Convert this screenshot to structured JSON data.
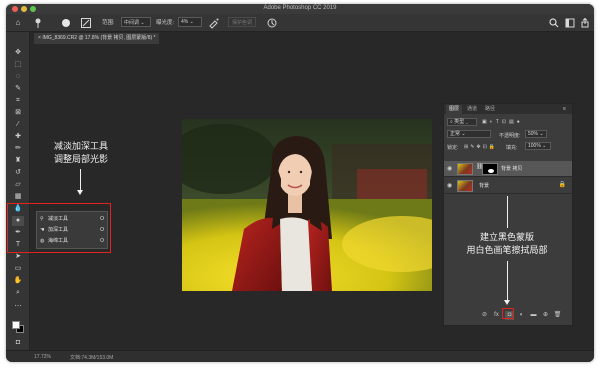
{
  "window": {
    "title": "Adobe Photoshop CC 2019"
  },
  "options_bar": {
    "range_label": "范围:",
    "range_value": "中间调",
    "exposure_label": "曝光度:",
    "exposure_value": "4%",
    "protect_tones_label": "保护色调",
    "icons": [
      "home-icon",
      "burn-brush-icon",
      "brush-size-icon",
      "brush-panel-icon",
      "airbrush-icon",
      "pressure-icon",
      "search-icon",
      "workspace-icon",
      "share-icon"
    ]
  },
  "document_tab": {
    "label": "IMG_8369.CR2 @ 17.8% (背景 拷贝, 图层蒙版/8) *"
  },
  "annotations": {
    "left_line1": "减淡加深工具",
    "left_line2": "调整局部光影",
    "right_line1": "建立黑色蒙版",
    "right_line2": "用白色画笔擦拭局部",
    "highlight_color": "#e0231c"
  },
  "tool_flyout": {
    "items": [
      {
        "icon": "dodge-icon",
        "label": "减淡工具",
        "shortcut": "O"
      },
      {
        "icon": "burn-icon",
        "label": "加深工具",
        "shortcut": "O"
      },
      {
        "icon": "sponge-icon",
        "label": "海绵工具",
        "shortcut": "O"
      }
    ]
  },
  "layers_panel": {
    "tabs": [
      "图层",
      "通道",
      "路径"
    ],
    "active_tab": "图层",
    "filter_kind": "类型",
    "blend_mode": "正常",
    "opacity_label": "不透明度:",
    "opacity_value": "50%",
    "lock_label": "锁定:",
    "fill_label": "填充:",
    "fill_value": "100%",
    "layers": [
      {
        "name": "背景 拷贝",
        "selected": true,
        "has_mask": true
      },
      {
        "name": "背景",
        "selected": false,
        "locked": true
      }
    ]
  },
  "status_bar": {
    "zoom": "17.72%",
    "doc_info": "文档:74.3M/153.0M"
  }
}
